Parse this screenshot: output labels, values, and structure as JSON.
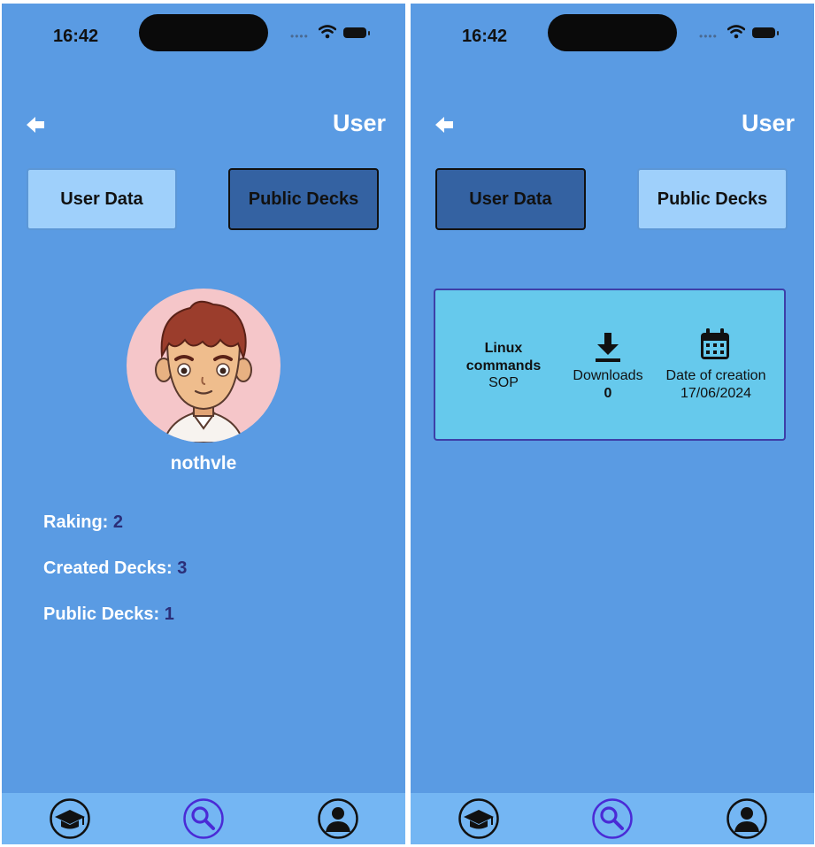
{
  "status": {
    "time": "16:42"
  },
  "header": {
    "title": "User"
  },
  "segments": {
    "user_data": "User Data",
    "public_decks": "Public Decks"
  },
  "profile": {
    "username": "nothvle",
    "stats": [
      {
        "label": "Raking:",
        "value": "2"
      },
      {
        "label": "Created Decks:",
        "value": "3"
      },
      {
        "label": "Public Decks:",
        "value": "1"
      }
    ]
  },
  "decks": [
    {
      "name_line1": "Linux",
      "name_line2": "commands",
      "language": "SOP",
      "downloads_label": "Downloads",
      "downloads": "0",
      "date_label": "Date of creation",
      "date": "17/06/2024"
    }
  ],
  "tabbar": {
    "items": [
      "graduation-cap-icon",
      "search-icon",
      "profile-icon"
    ],
    "active": "search-icon"
  },
  "colors": {
    "background": "#5a9be3",
    "tabbar": "#74b6f3",
    "button_light": "#9fd0fb",
    "button_active": "#3462a2",
    "card": "#66c9ec",
    "stat_value": "#2b2e78",
    "active_tab": "#4a2bd6"
  }
}
